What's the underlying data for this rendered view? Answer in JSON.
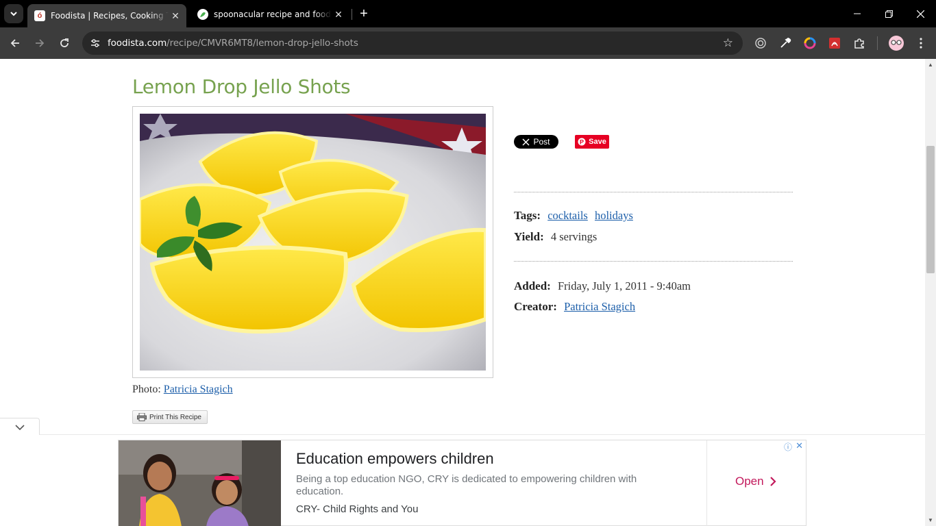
{
  "browser": {
    "tabs": [
      {
        "title": "Foodista | Recipes, Cooking Tips",
        "favicon": "foodista-icon",
        "active": true
      },
      {
        "title": "spoonacular recipe and food API",
        "favicon": "spoonacular-icon",
        "active": false
      }
    ],
    "url_domain": "foodista.com",
    "url_path": "/recipe/CMVR6MT8/lemon-drop-jello-shots",
    "extensions": [
      "target-icon",
      "eyedropper-icon",
      "color-circle-icon",
      "pdf-icon",
      "puzzle-icon"
    ],
    "profile": "profile-avatar"
  },
  "recipe": {
    "title": "Lemon Drop Jello Shots",
    "photo_alt": "Lemon wedges filled with yellow jello on a white plate",
    "photo_credit_label": "Photo:",
    "photo_credit_name": "Patricia Stagich",
    "print_label": "Print This Recipe",
    "share": {
      "x_label": "Post",
      "pin_label": "Save"
    },
    "tags_label": "Tags:",
    "tags": [
      "cocktails",
      "holidays"
    ],
    "yield_label": "Yield:",
    "yield_value": "4 servings",
    "added_label": "Added:",
    "added_value": "Friday, July 1, 2011 - 9:40am",
    "creator_label": "Creator:",
    "creator_name": "Patricia Stagich"
  },
  "ad": {
    "headline": "Education empowers children",
    "body": "Being a top education NGO, CRY is dedicated to empowering children with education.",
    "advertiser": "CRY- Child Rights and You",
    "cta": "Open"
  },
  "colors": {
    "title_green": "#77a24f",
    "link_blue": "#1d5faa",
    "ad_cta": "#c2185b",
    "pinterest_red": "#e60023"
  }
}
